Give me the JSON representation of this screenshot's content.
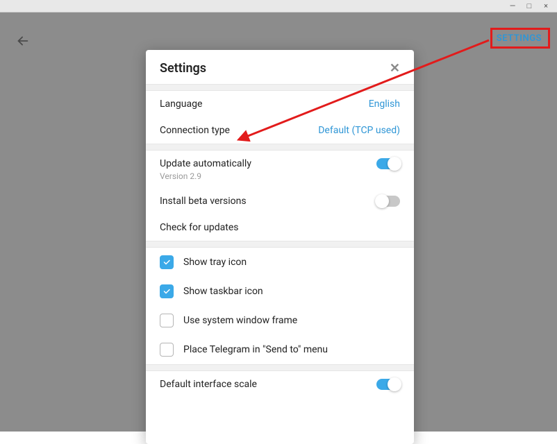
{
  "window": {
    "minimize": "—",
    "maximize": "□",
    "close": "×"
  },
  "header": {
    "settings_link": "SETTINGS"
  },
  "modal": {
    "title": "Settings",
    "close": "✕"
  },
  "general": {
    "language_label": "Language",
    "language_value": "English",
    "connection_label": "Connection type",
    "connection_value": "Default (TCP used)"
  },
  "updates": {
    "auto_label": "Update automatically",
    "version": "Version 2.9",
    "auto_on": true,
    "beta_label": "Install beta versions",
    "beta_on": false,
    "check_label": "Check for updates"
  },
  "system": {
    "tray_label": "Show tray icon",
    "tray_on": true,
    "taskbar_label": "Show taskbar icon",
    "taskbar_on": true,
    "frame_label": "Use system window frame",
    "frame_on": false,
    "sendto_label": "Place Telegram in \"Send to\" menu",
    "sendto_on": false
  },
  "scale": {
    "label": "Default interface scale",
    "on": true
  }
}
